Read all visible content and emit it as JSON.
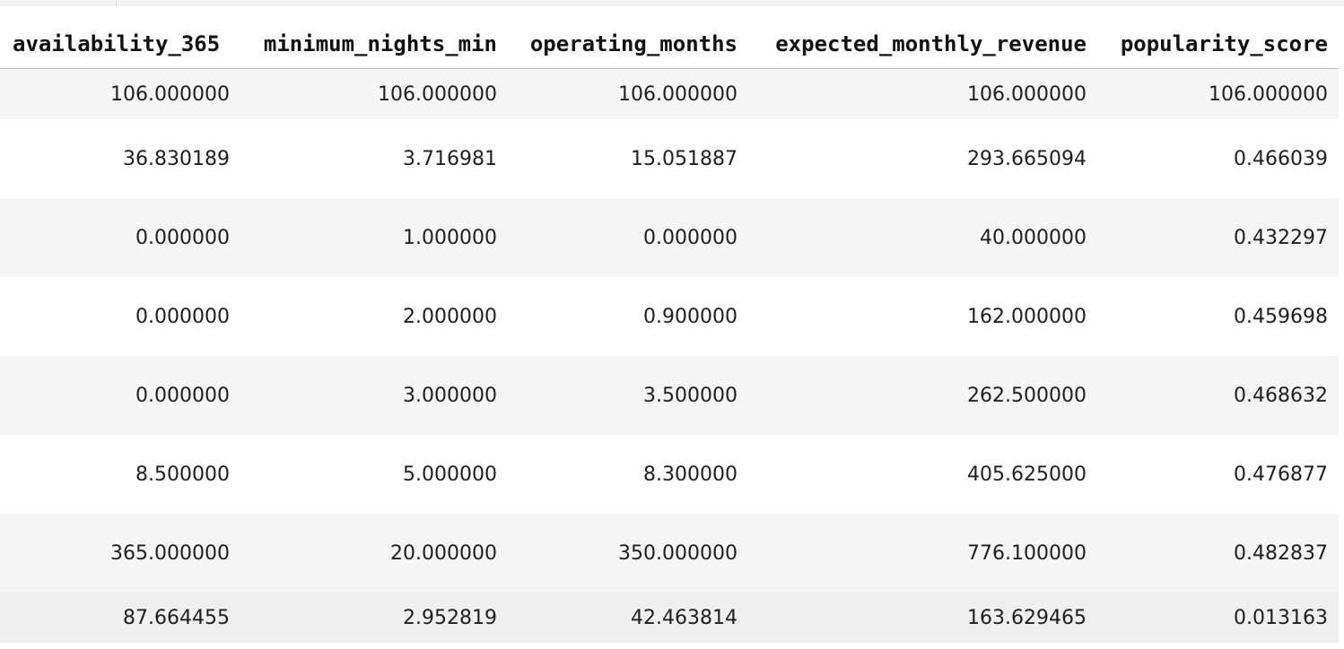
{
  "table": {
    "columns": [
      "availability_365",
      "minimum_nights_min",
      "operating_months",
      "expected_monthly_revenue",
      "popularity_score"
    ],
    "rows": [
      [
        "106.000000",
        "106.000000",
        "106.000000",
        "106.000000",
        "106.000000"
      ],
      [
        "36.830189",
        "3.716981",
        "15.051887",
        "293.665094",
        "0.466039"
      ],
      [
        "0.000000",
        "1.000000",
        "0.000000",
        "40.000000",
        "0.432297"
      ],
      [
        "0.000000",
        "2.000000",
        "0.900000",
        "162.000000",
        "0.459698"
      ],
      [
        "0.000000",
        "3.000000",
        "3.500000",
        "262.500000",
        "0.468632"
      ],
      [
        "8.500000",
        "5.000000",
        "8.300000",
        "405.625000",
        "0.476877"
      ],
      [
        "365.000000",
        "20.000000",
        "350.000000",
        "776.100000",
        "0.482837"
      ],
      [
        "87.664455",
        "2.952819",
        "42.463814",
        "163.629465",
        "0.013163"
      ]
    ]
  }
}
